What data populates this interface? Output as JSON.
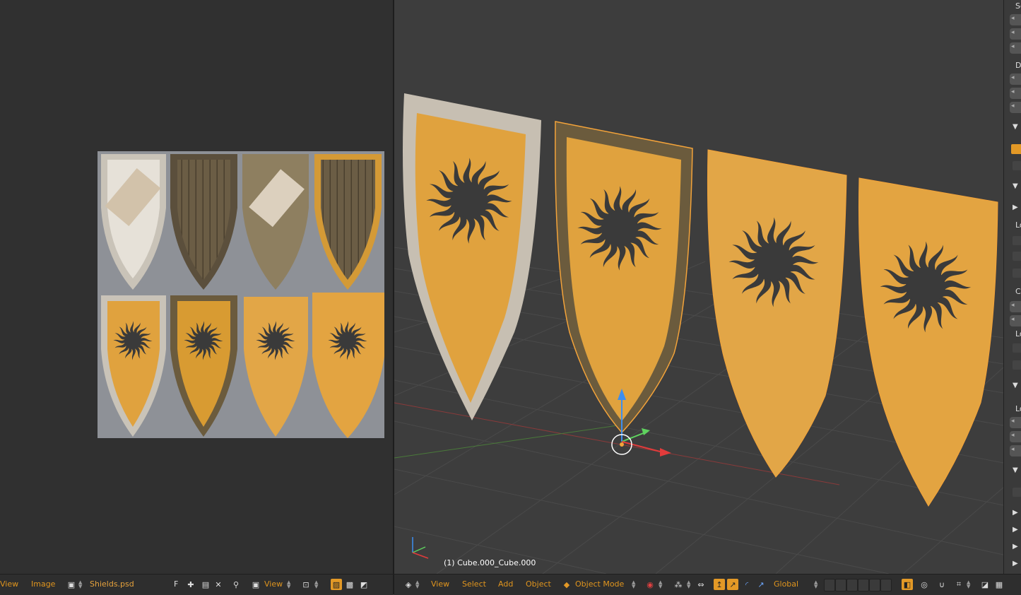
{
  "image_editor": {
    "header": {
      "view": "View",
      "image": "Image",
      "image_name": "Shields.psd",
      "f_label": "F",
      "view2": "View"
    }
  },
  "viewport": {
    "object_info": "(1) Cube.000_Cube.000",
    "header": {
      "view": "View",
      "select": "Select",
      "add": "Add",
      "object": "Object",
      "mode": "Object Mode",
      "orientation": "Global"
    }
  },
  "properties": {
    "labels": [
      "Sc",
      "D",
      "Lo",
      "Cl",
      "Lo",
      "Lo"
    ]
  },
  "colors": {
    "accent": "#e39926",
    "menu_text": "#e0951e",
    "viewport_bg": "#3d3d3d",
    "editor_bg": "#303030",
    "shield_yellow": "#e0a23e",
    "emblem": "#3a3a3a"
  }
}
